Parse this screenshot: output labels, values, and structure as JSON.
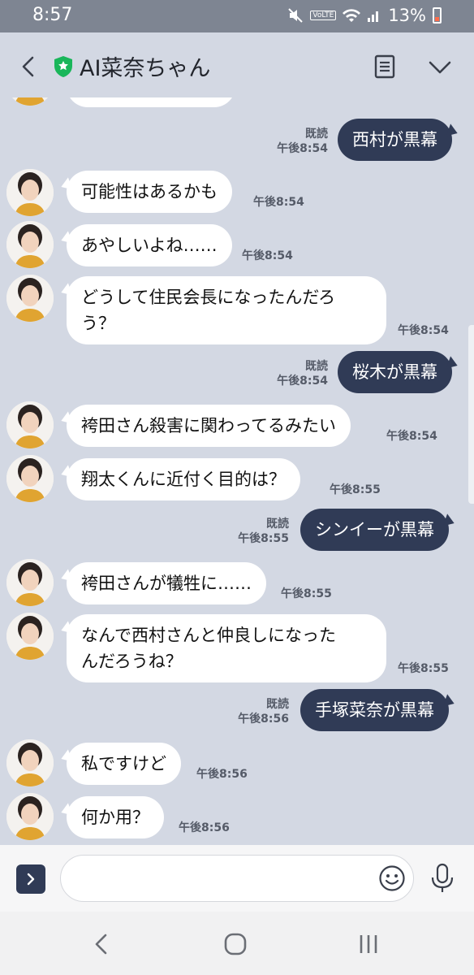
{
  "status_bar": {
    "time": "8:57",
    "battery_pct": "13%",
    "volte": "VoLTE"
  },
  "header": {
    "title": "AI菜奈ちゃん"
  },
  "messages": [
    {
      "dir": "out",
      "text": "西村が黒幕",
      "read": "既読",
      "time": "午後8:54"
    },
    {
      "dir": "in",
      "text": "可能性はあるかも",
      "time": "午後8:54"
    },
    {
      "dir": "in",
      "text": "あやしいよね……",
      "time": "午後8:54"
    },
    {
      "dir": "in",
      "text_lines": [
        "どうして住民会長になったんだろ",
        "う？"
      ],
      "time": "午後8:54"
    },
    {
      "dir": "out",
      "text": "桜木が黒幕",
      "read": "既読",
      "time": "午後8:54"
    },
    {
      "dir": "in",
      "text": "袴田さん殺害に関わってるみたい",
      "time": "午後8:54"
    },
    {
      "dir": "in",
      "text": "翔太くんに近付く目的は？",
      "time": "午後8:55"
    },
    {
      "dir": "out",
      "text": "シンイーが黒幕",
      "read": "既読",
      "time": "午後8:55"
    },
    {
      "dir": "in",
      "text": "袴田さんが犠牲に……",
      "time": "午後8:55"
    },
    {
      "dir": "in",
      "text_lines": [
        "なんで西村さんと仲良しになった",
        "んだろうね？"
      ],
      "time": "午後8:55"
    },
    {
      "dir": "out",
      "text": "手塚菜奈が黒幕",
      "read": "既読",
      "time": "午後8:56"
    },
    {
      "dir": "in",
      "text": "私ですけど",
      "time": "午後8:56"
    },
    {
      "dir": "in",
      "text": "何か用？",
      "time": "午後8:56"
    }
  ],
  "input": {
    "placeholder": ""
  },
  "colors": {
    "chat_bg": "#d3d8e3",
    "out_bubble": "#303b56",
    "in_bubble": "#ffffff",
    "verified_badge": "#19b65a"
  },
  "icons": [
    "back-icon",
    "verified-shield-icon",
    "notes-icon",
    "chevron-down-icon",
    "expand-icon",
    "emoji-icon",
    "mic-icon",
    "nav-back-icon",
    "nav-home-icon",
    "nav-recents-icon"
  ]
}
